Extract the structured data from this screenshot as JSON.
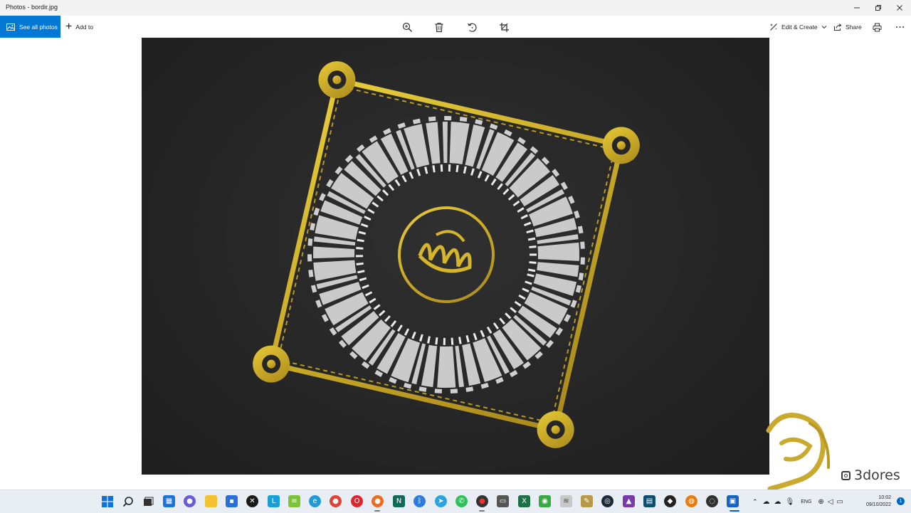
{
  "window": {
    "title": "Photos - bordir.jpg"
  },
  "toolbar": {
    "see_all": "See all photos",
    "add_to": "Add to",
    "edit_create": "Edit & Create",
    "share": "Share"
  },
  "watermark": {
    "handle": "3dores"
  },
  "taskbar": {
    "language": "ENG",
    "time": "10:02",
    "date": "09/10/2022",
    "notifications": "1",
    "apps": [
      "start",
      "search",
      "task-view",
      "widgets",
      "chat",
      "file-explorer",
      "store",
      "xbox",
      "l-app",
      "stack-app",
      "edge",
      "chrome",
      "opera",
      "firefox",
      "notepad",
      "bluetooth",
      "telegram",
      "whatsapp",
      "record",
      "media",
      "excel",
      "green-app",
      "lines-app",
      "paint",
      "steam",
      "affinity",
      "terminal",
      "inkscape",
      "blender",
      "obs",
      "photos"
    ]
  }
}
